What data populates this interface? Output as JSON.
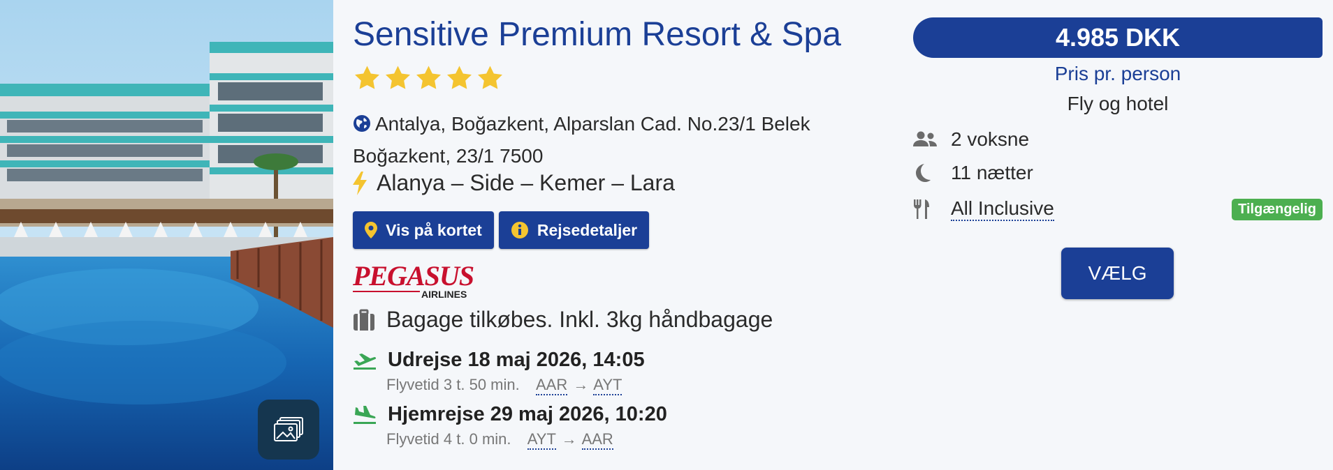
{
  "hotel": {
    "name": "Sensitive Premium Resort & Spa",
    "stars": 5,
    "address": "Antalya, Boğazkent, Alparslan Cad. No.23/1 Belek Boğazkent, 23/1 7500",
    "area": "Alanya – Side – Kemer – Lara"
  },
  "buttons": {
    "map": "Vis på kortet",
    "travel_details": "Rejsedetaljer",
    "select": "VÆLG"
  },
  "airline": {
    "name": "PEGASUS",
    "sub": "AIRLINES"
  },
  "baggage": "Bagage tilkøbes. Inkl. 3kg håndbagage",
  "outbound": {
    "label": "Udrejse 18 maj 2026, 14:05",
    "duration": "Flyvetid 3 t. 50 min.",
    "from": "AAR",
    "to": "AYT"
  },
  "return": {
    "label": "Hjemrejse 29 maj 2026, 10:20",
    "duration": "Flyvetid 4 t. 0 min.",
    "from": "AYT",
    "to": "AAR"
  },
  "price": {
    "amount": "4.985 DKK",
    "label": "Pris pr. person",
    "type": "Fly og hotel"
  },
  "details": {
    "travellers": "2 voksne",
    "nights": "11 nætter",
    "board": "All Inclusive",
    "availability": "Tilgængelig"
  },
  "icons": {
    "gallery": "gallery-icon",
    "globe": "globe-icon",
    "area": "lightning-icon",
    "map": "map-pin-icon",
    "info": "info-icon",
    "baggage": "suitcase-icon",
    "outbound": "plane-departure-icon",
    "return": "plane-arrival-icon",
    "travellers": "users-icon",
    "nights": "moon-icon",
    "board": "utensils-icon"
  },
  "colors": {
    "brand": "#1b3f96",
    "star": "#f4c430",
    "available": "#4caf50",
    "flight_icon": "#3aa655",
    "airline_red": "#c8102e"
  }
}
